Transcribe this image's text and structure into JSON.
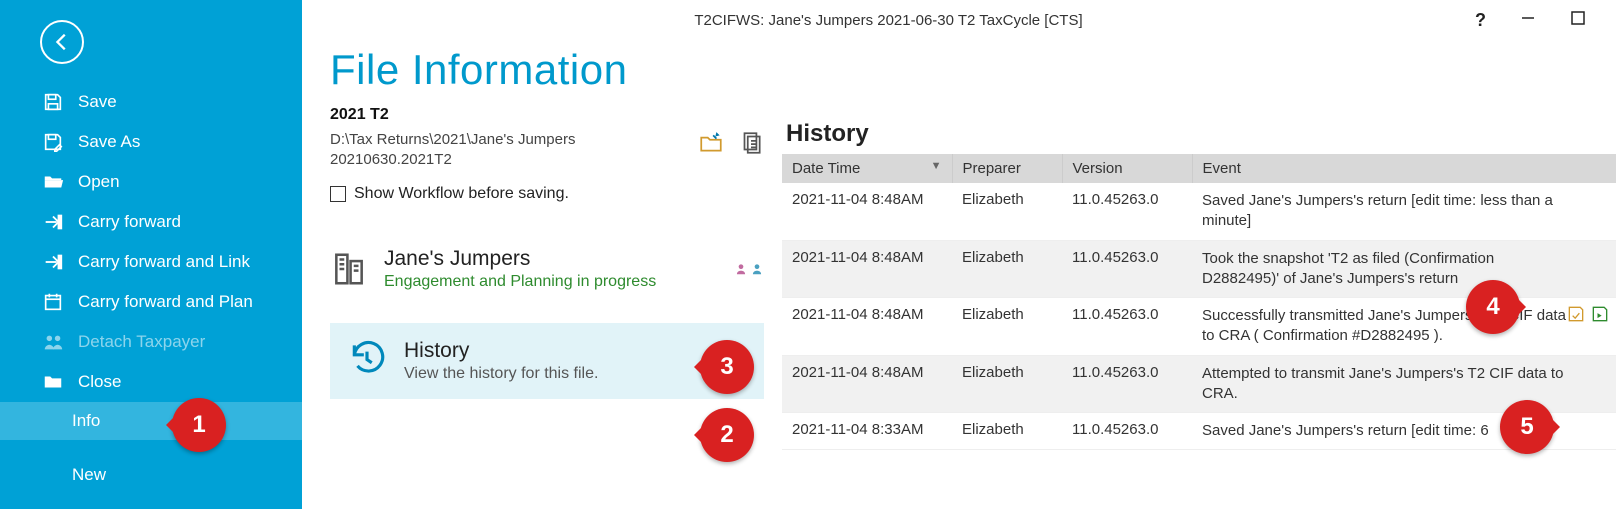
{
  "window_title": "T2CIFWS: Jane's Jumpers 2021-06-30 T2 TaxCycle [CTS]",
  "sidebar": {
    "items": [
      {
        "label": "Save"
      },
      {
        "label": "Save As"
      },
      {
        "label": "Open"
      },
      {
        "label": "Carry forward"
      },
      {
        "label": "Carry forward and Link"
      },
      {
        "label": "Carry forward and Plan"
      },
      {
        "label": "Detach Taxpayer"
      },
      {
        "label": "Close"
      },
      {
        "label": "Info"
      },
      {
        "label": "New"
      }
    ]
  },
  "page": {
    "heading": "File Information",
    "sub": "2021 T2",
    "path": "D:\\Tax Returns\\2021\\Jane's Jumpers 20210630.2021T2",
    "workflow_label": "Show Workflow before saving.",
    "client_name": "Jane's Jumpers",
    "client_status": "Engagement and Planning in progress",
    "history_card_title": "History",
    "history_card_desc": "View the history for this file."
  },
  "history": {
    "title": "History",
    "headers": {
      "dt": "Date Time",
      "prep": "Preparer",
      "ver": "Version",
      "ev": "Event"
    },
    "rows": [
      {
        "dt": "2021-11-04 8:48AM",
        "prep": "Elizabeth",
        "ver": "11.0.45263.0",
        "ev": "Saved Jane's Jumpers's return [edit time: less than a minute]"
      },
      {
        "dt": "2021-11-04 8:48AM",
        "prep": "Elizabeth",
        "ver": "11.0.45263.0",
        "ev": "Took the snapshot 'T2 as filed (Confirmation D2882495)' of Jane's Jumpers's return"
      },
      {
        "dt": "2021-11-04 8:48AM",
        "prep": "Elizabeth",
        "ver": "11.0.45263.0",
        "ev": "Successfully transmitted Jane's Jumpers's T2 CIF data to CRA ( Confirmation #D2882495 )."
      },
      {
        "dt": "2021-11-04 8:48AM",
        "prep": "Elizabeth",
        "ver": "11.0.45263.0",
        "ev": "Attempted to transmit Jane's Jumpers's T2 CIF data to CRA."
      },
      {
        "dt": "2021-11-04 8:33AM",
        "prep": "Elizabeth",
        "ver": "11.0.45263.0",
        "ev": "Saved Jane's Jumpers's return [edit time: 6"
      }
    ]
  },
  "callouts": {
    "c1": "1",
    "c2": "2",
    "c3": "3",
    "c4": "4",
    "c5": "5"
  }
}
